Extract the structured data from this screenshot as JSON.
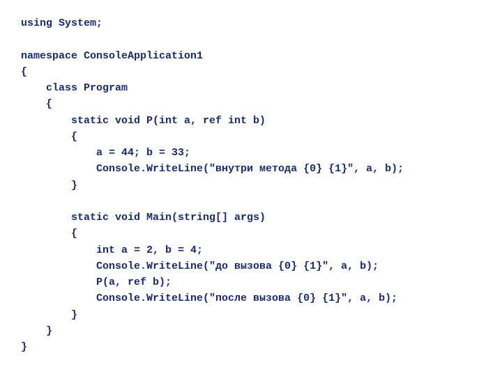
{
  "code": {
    "lines": [
      "using System;",
      "",
      "namespace ConsoleApplication1",
      "{",
      "    class Program",
      "    {",
      "        static void P(int a, ref int b)",
      "        {",
      "            a = 44; b = 33;",
      "            Console.WriteLine(\"внутри метода {0} {1}\", a, b);",
      "        }",
      "",
      "        static void Main(string[] args)",
      "        {",
      "            int a = 2, b = 4;",
      "            Console.WriteLine(\"до вызова {0} {1}\", a, b);",
      "            P(a, ref b);",
      "            Console.WriteLine(\"после вызова {0} {1}\", a, b);",
      "        }",
      "    }",
      "}"
    ]
  }
}
